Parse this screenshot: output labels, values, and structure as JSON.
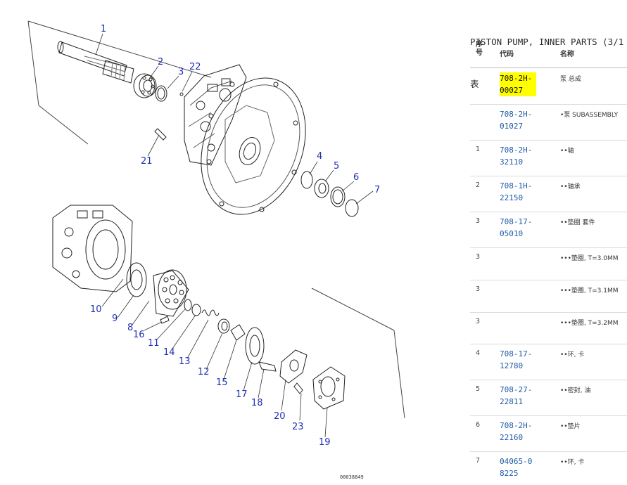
{
  "diagram": {
    "callouts": [
      "1",
      "2",
      "3",
      "22",
      "21",
      "4",
      "5",
      "6",
      "7",
      "10",
      "9",
      "8",
      "16",
      "11",
      "14",
      "13",
      "12",
      "15",
      "17",
      "18",
      "20",
      "23",
      "19"
    ],
    "drawing_number": "00038849"
  },
  "panel": {
    "title": "PISTON PUMP, INNER PARTS (3/1",
    "title_cont": "表",
    "columns": {
      "seq": "序\n号",
      "code": "代码",
      "name": "名称"
    },
    "rows": [
      {
        "seq": "",
        "code": "708-2H-00027",
        "name": "泵 总成",
        "highlight": true
      },
      {
        "seq": "",
        "code": "708-2H-01027",
        "name": "•泵 SUBASSEMBLY"
      },
      {
        "seq": "1",
        "code": "708-2H-32110",
        "name": "••轴"
      },
      {
        "seq": "2",
        "code": "708-1H-22150",
        "name": "••轴承"
      },
      {
        "seq": "3",
        "code": "708-17-05010",
        "name": "••垫圈 套件"
      },
      {
        "seq": "3",
        "code": "",
        "name": "•••垫圈, T=3.0MM"
      },
      {
        "seq": "3",
        "code": "",
        "name": "•••垫圈, T=3.1MM"
      },
      {
        "seq": "3",
        "code": "",
        "name": "•••垫圈, T=3.2MM"
      },
      {
        "seq": "4",
        "code": "708-17-12780",
        "name": "••环, 卡"
      },
      {
        "seq": "5",
        "code": "708-27-22811",
        "name": "••密封, 油"
      },
      {
        "seq": "6",
        "code": "708-2H-22160",
        "name": "••垫片"
      },
      {
        "seq": "7",
        "code": "04065-08225",
        "name": "••环, 卡"
      }
    ]
  }
}
